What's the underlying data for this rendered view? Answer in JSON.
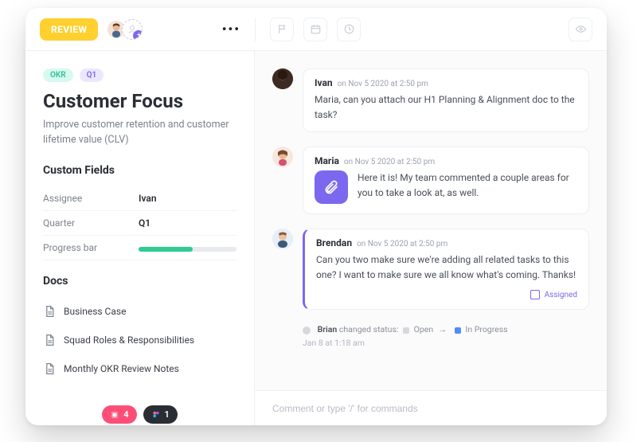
{
  "topbar": {
    "review_badge": "REVIEW"
  },
  "left": {
    "tags": {
      "okr": "OKR",
      "q1": "Q1"
    },
    "title": "Customer Focus",
    "subtitle": "Improve customer retention and customer lifetime value (CLV)",
    "custom_fields_header": "Custom Fields",
    "fields": {
      "assignee_label": "Assignee",
      "assignee_value": "Ivan",
      "quarter_label": "Quarter",
      "quarter_value": "Q1",
      "progress_label": "Progress bar",
      "progress_percent": 55
    },
    "docs_header": "Docs",
    "docs": [
      {
        "label": "Business Case"
      },
      {
        "label": "Squad Roles & Responsibilities"
      },
      {
        "label": "Monthly OKR Review Notes"
      }
    ],
    "pills": {
      "pink_count": "4",
      "dark_count": "1"
    }
  },
  "feed": {
    "messages": [
      {
        "author": "Ivan",
        "meta": "on Nov 5 2020 at 2:50 pm",
        "text": "Maria, can you attach our H1 Planning & Alignment doc to the task?"
      },
      {
        "author": "Maria",
        "meta": "on Nov 5 2020 at 2:50 pm",
        "text": "Here it is! My team commented a couple areas for you to take a look at, as well."
      },
      {
        "author": "Brendan",
        "meta": "on Nov 5 2020 at 2:50 pm",
        "text": "Can you two make sure we're adding all related tasks to this one? I want to make sure we all know what's coming. Thanks!",
        "assigned_label": "Assigned"
      }
    ],
    "status_change": {
      "actor": "Brian",
      "verb": "changed status:",
      "from": "Open",
      "to": "In Progress",
      "from_color": "#d6d8de",
      "to_color": "#4f8ff7",
      "timestamp": "Jan 8 at 1:18 am"
    }
  },
  "composer": {
    "placeholder": "Comment or type '/' for commands"
  }
}
